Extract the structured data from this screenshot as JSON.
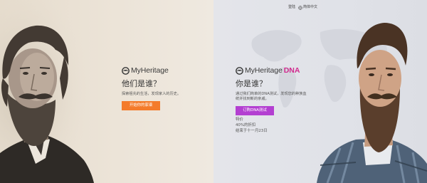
{
  "header": {
    "login_label": "登陆",
    "language_label": "简体中文"
  },
  "left": {
    "brand": "MyHeritage",
    "heading": "他们是谁？",
    "description": "探索祖先的生活，发现家人的历史。",
    "cta_label": "开始你的家谱"
  },
  "right": {
    "brand": "MyHeritage",
    "brand_suffix": "DNA",
    "heading": "你是谁？",
    "description_line1": "通过我们简单的DNA测试，发现您的种族血",
    "description_line2": "统并找到新的亲戚。",
    "cta_label": "订购DNA测试",
    "offer": {
      "line1": "特价",
      "line2": "40%的折扣",
      "line3": "结束于十一月23日"
    }
  },
  "colors": {
    "accent_orange": "#f47b2b",
    "accent_purple": "#b33fd1",
    "dna_pink": "#d12a8e"
  }
}
